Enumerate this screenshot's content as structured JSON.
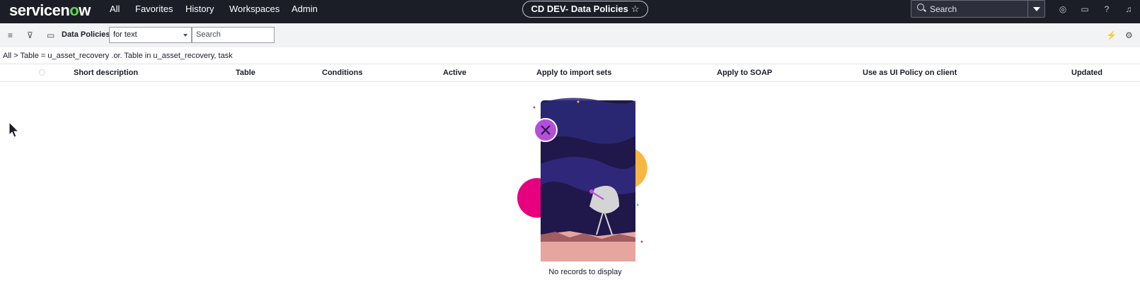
{
  "header": {
    "logo_main": "servicen",
    "logo_o": "o",
    "logo_tail": "w",
    "nav": [
      "All",
      "Favorites",
      "History",
      "Workspaces",
      "Admin"
    ],
    "instance_title": "CD DEV- Data Policies",
    "search_placeholder": "Search",
    "icons": [
      "globe-icon",
      "chat-icon",
      "help-icon",
      "bell-icon"
    ]
  },
  "toolbar": {
    "list_title": "Data Policies",
    "filter_select_value": "for text",
    "search_placeholder": "Search"
  },
  "breadcrumb": "All > Table = u_asset_recovery .or. Table in u_asset_recovery, task",
  "table": {
    "columns": [
      "Short description",
      "Table",
      "Conditions",
      "Active",
      "Apply to import sets",
      "Apply to SOAP",
      "Use as UI Policy on client",
      "Updated"
    ],
    "rows": [],
    "empty_message": "No records to display"
  },
  "colors": {
    "header_bg": "#1b1d27",
    "brand_green": "#62d84e",
    "toolbar_bg": "#f2f3f4"
  }
}
